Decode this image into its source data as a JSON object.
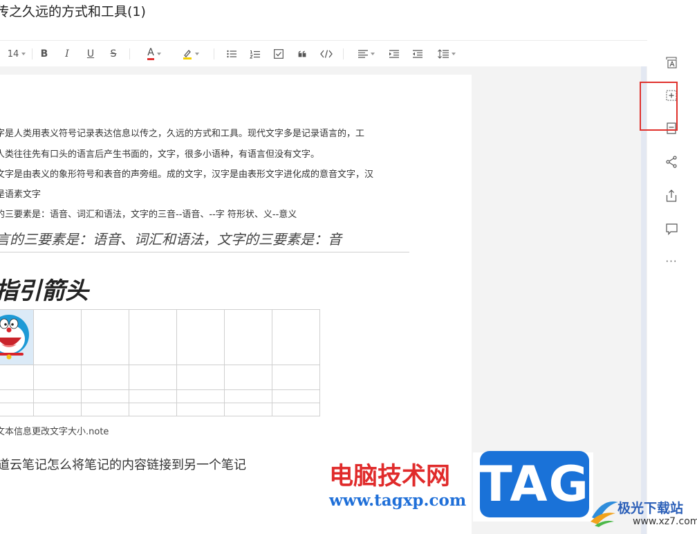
{
  "doc": {
    "title": "传之久远的方式和工具(1)"
  },
  "toolbar": {
    "font_size": "14",
    "icons": [
      "bold-icon",
      "italic-icon",
      "underline-icon",
      "strikethrough-icon",
      "font-color-icon",
      "highlight-icon",
      "bullet-list-icon",
      "numbered-list-icon",
      "checkbox-icon",
      "quote-icon",
      "code-icon",
      "align-icon",
      "indent-icon",
      "outdent-icon",
      "line-height-icon"
    ],
    "bold": "B",
    "italic": "I",
    "underline": "U",
    "strike": "S",
    "font_color_letter": "A",
    "font_color": "#e03030",
    "highlight_color": "#f5d000"
  },
  "content": {
    "paragraphs": [
      "字是人类用表义符号记录表达信息以传之，久远的方式和工具。现代文字多是记录语言的，工",
      "人类往往先有口头的语言后产生书面的，文字，很多小语种，有语言但没有文字。",
      "文字是由表义的象形符号和表音的声旁组。成的文字，汉字是由表形文字进化成的意音文字，汉",
      "是语素文字",
      "的三要素是：语音、词汇和语法，文字的三音--语音、--字 符形状、义--意义"
    ],
    "quote": "言的三要素是：语音、词汇和语法，文字的三要素是：音",
    "heading": "指引箭头",
    "note_link": "文本信息更改文字大小.note",
    "link_title": "道云笔记怎么将笔记的内容链接到另一个笔记"
  },
  "sidebar": {
    "icons": [
      "text-format-icon",
      "add-block-icon",
      "outline-icon",
      "share-icon",
      "export-icon",
      "comment-icon",
      "more-icon"
    ],
    "more_label": "···"
  },
  "watermark": {
    "site_cn": "电脑技术网",
    "url": "www.tagxp.com",
    "tag": "TAG",
    "logo_name": "极光下载站",
    "logo_url": "www.xz7.com"
  },
  "colors": {
    "highlight_box": "#e0302b",
    "brand_blue": "#1a72d8",
    "watermark_red": "#e02b2b"
  }
}
